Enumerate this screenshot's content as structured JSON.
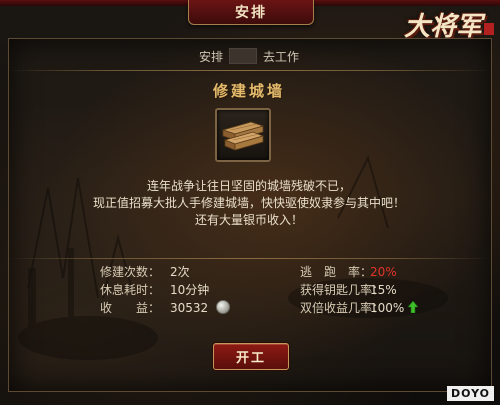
{
  "window": {
    "title": "安排"
  },
  "logo": {
    "text": "大将军"
  },
  "assign": {
    "prefix": "安排",
    "suffix": "去工作"
  },
  "task": {
    "name": "修建城墙",
    "icon": "lumber-planks-icon",
    "description": [
      "连年战争让往日坚固的城墙残破不已，",
      "现正值招募大批人手修建城墙，快快驱使奴隶参与其中吧！",
      "还有大量银币收入！"
    ]
  },
  "stats": {
    "left": [
      {
        "label": "修建次数：",
        "value": "2次"
      },
      {
        "label": "休息耗时：",
        "value": "10分钟"
      },
      {
        "label": "收　　益：",
        "value": "30532",
        "icon": "silver-coin-icon"
      }
    ],
    "right": [
      {
        "label": "逃　跑　率：",
        "value": "20%",
        "color": "#e2332b"
      },
      {
        "label": "获得钥匙几率：",
        "value": "15%"
      },
      {
        "label": "双倍收益几率：",
        "value": "100%",
        "icon": "green-up-arrow-icon"
      }
    ]
  },
  "actions": {
    "start_label": "开工"
  },
  "watermark": "DOYO",
  "colors": {
    "accent": "#e4ba6c",
    "button": "#8e1a14",
    "warning": "#e2332b",
    "positive": "#3fbf2a"
  }
}
